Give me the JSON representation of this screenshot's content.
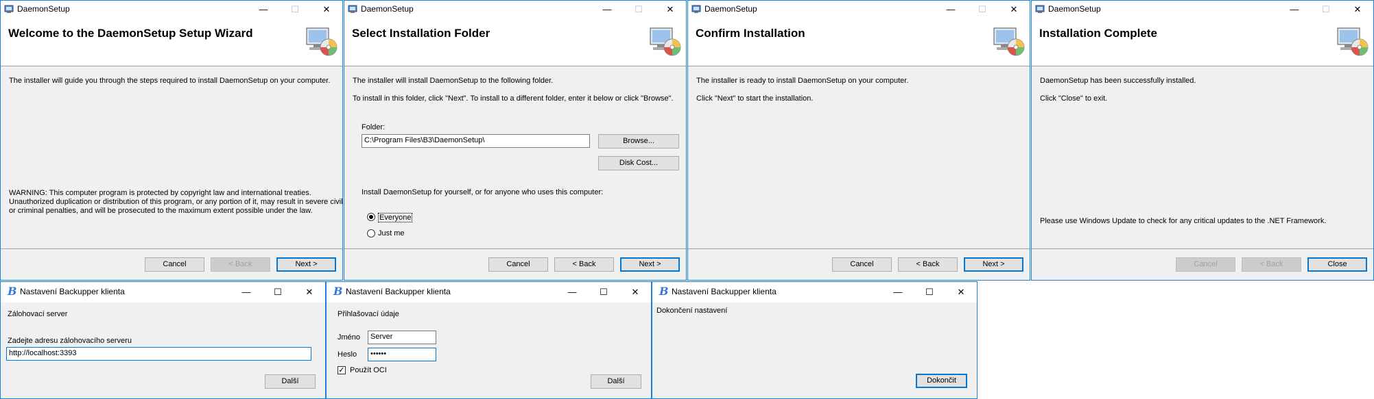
{
  "installer": {
    "app_title": "DaemonSetup",
    "minimize_glyph": "—",
    "maximize_glyph": "☐",
    "close_glyph": "✕",
    "welcome": {
      "heading": "Welcome to the DaemonSetup Setup Wizard",
      "intro": "The installer will guide you through the steps required to install DaemonSetup on your computer.",
      "warning_lines": [
        "WARNING: This computer program is protected by copyright law and international treaties.",
        "Unauthorized duplication or distribution of this program, or any portion of it, may result in severe civil",
        "or criminal penalties, and will be prosecuted to the maximum extent possible under the law."
      ],
      "cancel": "Cancel",
      "back": "< Back",
      "next": "Next >"
    },
    "folder": {
      "heading": "Select Installation Folder",
      "line1": "The installer will install DaemonSetup to the following folder.",
      "line2": "To install in this folder, click \"Next\". To install to a different folder, enter it below or click \"Browse\".",
      "folder_label": "Folder:",
      "folder_value": "C:\\Program Files\\B3\\DaemonSetup\\",
      "browse": "Browse...",
      "disk_cost": "Disk Cost...",
      "install_for": "Install DaemonSetup for yourself, or for anyone who uses this computer:",
      "everyone": "Everyone",
      "just_me": "Just me",
      "cancel": "Cancel",
      "back": "< Back",
      "next": "Next >"
    },
    "confirm": {
      "heading": "Confirm Installation",
      "line1": "The installer is ready to install DaemonSetup on your computer.",
      "line2": "Click \"Next\" to start the installation.",
      "cancel": "Cancel",
      "back": "< Back",
      "next": "Next >"
    },
    "complete": {
      "heading": "Installation Complete",
      "line1": "DaemonSetup has been successfully installed.",
      "line2": "Click \"Close\" to exit.",
      "update_note": "Please use Windows Update to check for any critical updates to the .NET Framework.",
      "cancel": "Cancel",
      "back": "< Back",
      "close": "Close"
    }
  },
  "backupper": {
    "app_title": "Nastavení Backupper klienta",
    "app_icon_glyph": "B",
    "minimize_glyph": "—",
    "maximize_glyph": "☐",
    "close_glyph": "✕",
    "server": {
      "heading": "Zálohovací server",
      "label": "Zadejte adresu zálohovacího serveru",
      "value": "http://localhost:3393",
      "next": "Další"
    },
    "login": {
      "heading": "Přihlašovací údaje",
      "name_label": "Jméno",
      "name_value": "Server",
      "password_label": "Heslo",
      "password_value": "••••••",
      "use_oci": "Použít OCI",
      "next": "Další"
    },
    "finish": {
      "heading": "Dokončení nastavení",
      "finish_button": "Dokončit"
    }
  },
  "colors": {
    "accent": "#0078d7",
    "window_border": "#1a7fd8",
    "dialog_bg": "#f0f0f0"
  },
  "icons": [
    "installer-app-icon",
    "setup-computer-cd-icon",
    "backupper-b-icon",
    "minimize-icon",
    "maximize-icon",
    "close-icon",
    "checkmark-icon"
  ]
}
